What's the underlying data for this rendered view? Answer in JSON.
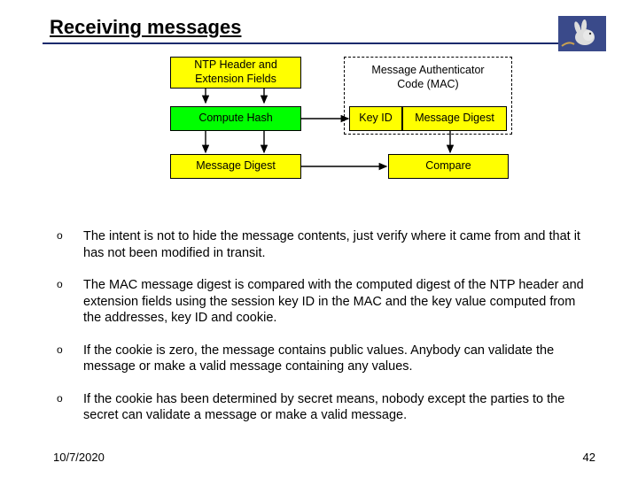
{
  "title": "Receiving messages",
  "diagram": {
    "ntp_header": "NTP Header and\nExtension Fields",
    "compute_hash": "Compute Hash",
    "message_digest_left": "Message Digest",
    "mac_label": "Message Authenticator\nCode (MAC)",
    "key_id": "Key ID",
    "message_digest_right": "Message Digest",
    "compare": "Compare"
  },
  "bullets": [
    "The intent is not to hide the message contents, just verify where it came from and that it has not been modified in transit.",
    "The MAC message digest is compared with the computed digest of the NTP header and extension fields using the session key ID in the MAC and the key value computed from the addresses, key ID and cookie.",
    "If the cookie is zero, the message contains public values. Anybody can validate the message or make a valid message containing any values.",
    "If the cookie has been determined by secret means, nobody except the parties to the secret can validate a message or make a valid message."
  ],
  "footer": {
    "date": "10/7/2020",
    "page": "42"
  }
}
